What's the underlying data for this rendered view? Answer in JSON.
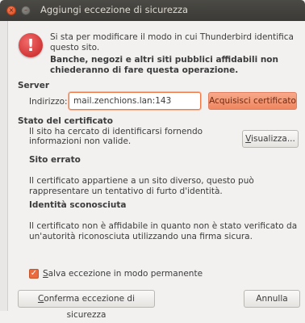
{
  "window": {
    "title": "Aggiungi eccezione di sicurezza",
    "close_glyph": "×",
    "min_glyph": "–"
  },
  "intro": {
    "icon": "!",
    "line1": "Si sta per modificare il modo in cui Thunderbird identifica",
    "line2": "questo sito.",
    "bold_line1": "Banche, negozi e altri siti pubblici affidabili non",
    "bold_line2": "chiederanno di fare questa operazione."
  },
  "server": {
    "heading": "Server",
    "address_label": "Indirizzo:",
    "address_value": "mail.zenchions.lan:143",
    "acquire_button": "Acquisisci certificato"
  },
  "status": {
    "heading": "Stato del certificato",
    "line1": "Il sito ha cercato di identificarsi fornendo",
    "line2": "informazioni non valide.",
    "view_button_u": "V",
    "view_button_rest": "isualizza..."
  },
  "wrong_site": {
    "heading": "Sito errato",
    "line1": "Il certificato appartiene a un sito diverso, questo può",
    "line2": "rappresentare un tentativo di furto d'identità."
  },
  "unknown_identity": {
    "heading": "Identità sconosciuta",
    "line1": "Il certificato non è affidabile in quanto non è stato verificato da",
    "line2": "un'autorità riconosciuta utilizzando una firma sicura."
  },
  "permanent": {
    "checked": true,
    "check_glyph": "✓",
    "label_u": "S",
    "label_rest": "alva eccezione in modo permanente"
  },
  "buttons": {
    "confirm_u": "C",
    "confirm_rest": "onferma eccezione di sicurezza",
    "cancel": "Annulla"
  },
  "colors": {
    "accent": "#f07746",
    "titlebar": "#3c3b37",
    "warning": "#d9322f"
  }
}
